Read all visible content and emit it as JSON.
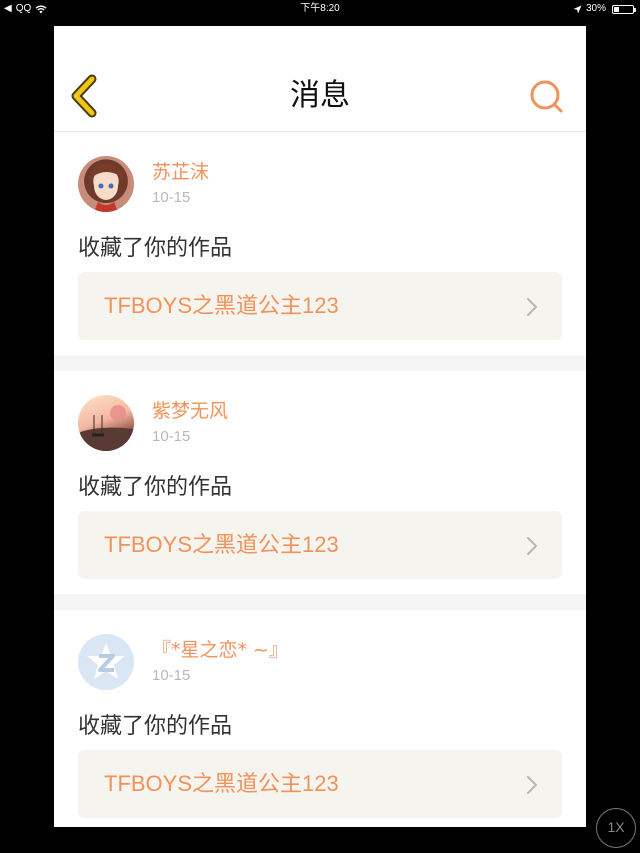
{
  "status_bar": {
    "carrier": "QQ",
    "time": "下午8:20",
    "battery": "30%",
    "battery_level": 0.3
  },
  "header": {
    "title": "消息"
  },
  "colors": {
    "accent": "#f2925a",
    "back_icon": "#f0c419"
  },
  "messages": [
    {
      "username": "苏芷沫",
      "date": "10-15",
      "action": "收藏了你的作品",
      "work_title": "TFBOYS之黑道公主123"
    },
    {
      "username": "紫梦无风",
      "date": "10-15",
      "action": "收藏了你的作品",
      "work_title": "TFBOYS之黑道公主123"
    },
    {
      "username": "『*星之恋* ~』",
      "date": "10-15",
      "action": "收藏了你的作品",
      "work_title": "TFBOYS之黑道公主123"
    }
  ],
  "zoom_button": "1X"
}
